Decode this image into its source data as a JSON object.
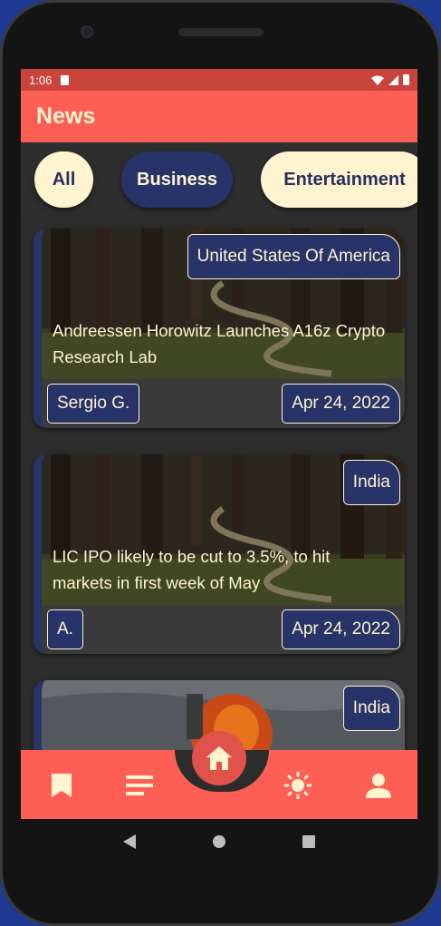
{
  "status_bar": {
    "time": "1:06"
  },
  "app_bar": {
    "title": "News"
  },
  "categories": [
    {
      "label": "All",
      "selected": false
    },
    {
      "label": "Business",
      "selected": true
    },
    {
      "label": "Entertainment",
      "selected": false
    }
  ],
  "articles": [
    {
      "country": "United States Of America",
      "headline": "Andreessen Horowitz Launches A16z Crypto Research Lab",
      "author": "Sergio G.",
      "date": "Apr 24, 2022"
    },
    {
      "country": "India",
      "headline": "LIC IPO likely to be cut to 3.5%, to hit markets in first week of May",
      "author": "A.",
      "date": "Apr 24, 2022"
    },
    {
      "country": "India"
    }
  ],
  "bottom_nav": [
    "bookmark-icon",
    "list-icon",
    "home-icon",
    "sun-icon",
    "person-icon"
  ],
  "colors": {
    "accent": "#fe5f55",
    "status_bar": "#c9443a",
    "navy": "#28336a",
    "cream": "#fff3d0",
    "background": "#2c2c2c"
  }
}
